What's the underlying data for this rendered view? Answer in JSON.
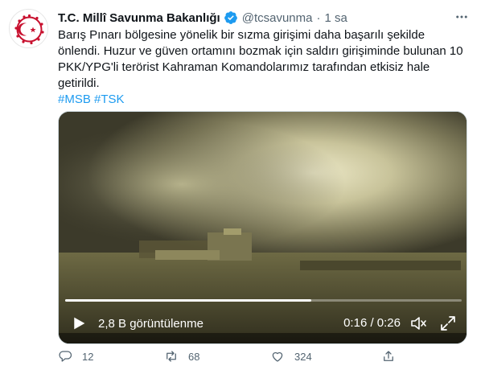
{
  "account": {
    "display_name": "T.C. Millî Savunma Bakanlığı",
    "handle": "@tcsavunma",
    "separator": "·",
    "time": "1 sa",
    "verified": true
  },
  "tweet": {
    "text": "Barış Pınarı bölgesine yönelik bir sızma girişimi daha başarılı şekilde önlendi. Huzur ve güven ortamını bozmak için saldırı girişiminde bulunan 10 PKK/YPG'li terörist Kahraman Komandolarımız tarafından etkisiz hale getirildi.",
    "hashtags": [
      "#MSB",
      "#TSK"
    ]
  },
  "video": {
    "views": "2,8 B görüntülenme",
    "timecode": "0:16 / 0:26",
    "progress": 0.62
  },
  "actions": {
    "reply_count": "12",
    "retweet_count": "68",
    "like_count": "324"
  },
  "colors": {
    "accent": "#1d9bf0",
    "text": "#0f1419",
    "muted": "#536471"
  }
}
